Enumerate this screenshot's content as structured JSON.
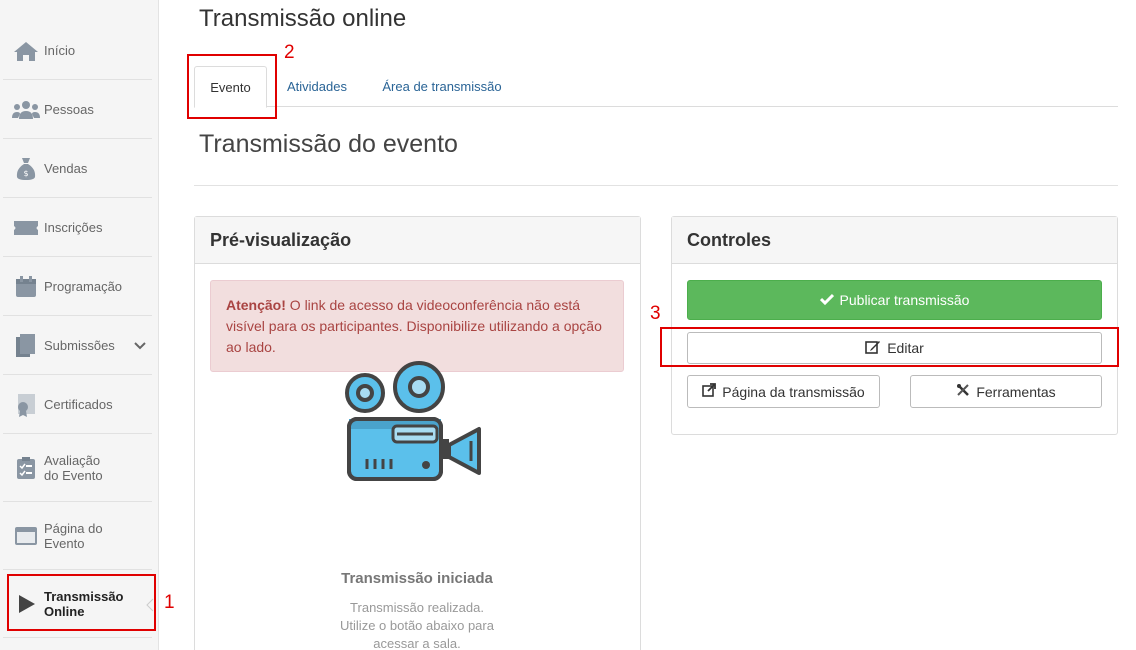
{
  "sidebar": {
    "items": [
      {
        "label": "Início"
      },
      {
        "label": "Pessoas"
      },
      {
        "label": "Vendas"
      },
      {
        "label": "Inscrições"
      },
      {
        "label": "Programação"
      },
      {
        "label": "Submissões"
      },
      {
        "label": "Certificados"
      },
      {
        "label": "Avaliação",
        "label2": "do Evento"
      },
      {
        "label": "Página do",
        "label2": "Evento"
      },
      {
        "label": "Transmissão",
        "label2": "Online"
      }
    ]
  },
  "header": {
    "title": "Transmissão online"
  },
  "tabs": [
    {
      "label": "Evento"
    },
    {
      "label": "Atividades"
    },
    {
      "label": "Área de transmissão"
    }
  ],
  "main": {
    "section_title": "Transmissão do evento"
  },
  "preview": {
    "title": "Pré-visualização",
    "alert_strong": "Atenção!",
    "alert_text": " O link de acesso da videoconferência não está visível para os participantes. Disponibilize utilizando a opção ao lado.",
    "status_title": "Transmissão iniciada",
    "status_line1": "Transmissão realizada.",
    "status_line2": "Utilize o botão abaixo para",
    "status_line3": "acessar a sala."
  },
  "controls": {
    "title": "Controles",
    "publish_label": "Publicar transmissão",
    "edit_label": "Editar",
    "page_label": "Página da transmissão",
    "tools_label": "Ferramentas"
  },
  "annotations": {
    "a1": "1",
    "a2": "2",
    "a3": "3"
  },
  "colors": {
    "accent_green": "#5cb85c",
    "annotation_red": "#e00000",
    "link_blue": "#2a6496",
    "camera_blue": "#5bc0eb"
  }
}
